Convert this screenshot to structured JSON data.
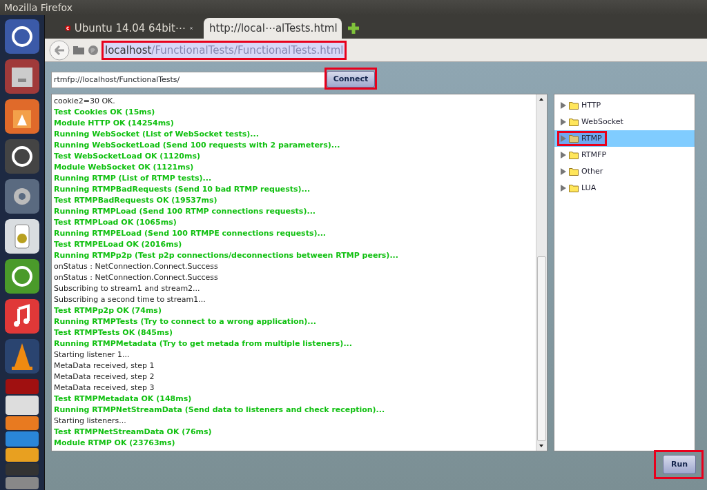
{
  "window": {
    "title": "Mozilla Firefox"
  },
  "tabs": [
    {
      "title": "Ubuntu 14.04 64bit⋯",
      "selected": false
    },
    {
      "title": "http://local⋯alTests.html",
      "selected": true
    }
  ],
  "address_bar": {
    "host": "localhost",
    "path": "/FunctionalTests/FunctionalTests.html",
    "highlighted": true
  },
  "server_field": {
    "value": "rtmfp://localhost/FunctionalTests/"
  },
  "connect_button": {
    "label": "Connect",
    "highlighted": true
  },
  "log": {
    "lines": [
      {
        "text": "cookie2=30 OK.",
        "kind": "info"
      },
      {
        "text": "Test Cookies OK (15ms)",
        "kind": "success"
      },
      {
        "text": "Module HTTP OK (14254ms)",
        "kind": "success"
      },
      {
        "text": "Running WebSocket (List of WebSocket tests)...",
        "kind": "success"
      },
      {
        "text": "Running WebSocketLoad (Send 100 requests with 2 parameters)...",
        "kind": "success"
      },
      {
        "text": "Test WebSocketLoad OK (1120ms)",
        "kind": "success"
      },
      {
        "text": "Module WebSocket OK (1121ms)",
        "kind": "success"
      },
      {
        "text": "Running RTMP (List of RTMP tests)...",
        "kind": "success"
      },
      {
        "text": "Running RTMPBadRequests (Send 10 bad RTMP requests)...",
        "kind": "success"
      },
      {
        "text": "Test RTMPBadRequests OK (19537ms)",
        "kind": "success"
      },
      {
        "text": "Running RTMPLoad (Send 100 RTMP connections requests)...",
        "kind": "success"
      },
      {
        "text": "Test RTMPLoad OK (1065ms)",
        "kind": "success"
      },
      {
        "text": "Running RTMPELoad (Send 100 RTMPE connections requests)...",
        "kind": "success"
      },
      {
        "text": "Test RTMPELoad OK (2016ms)",
        "kind": "success"
      },
      {
        "text": "Running RTMPp2p (Test p2p connections/deconnections between RTMP peers)...",
        "kind": "success"
      },
      {
        "text": "onStatus : NetConnection.Connect.Success",
        "kind": "info"
      },
      {
        "text": "onStatus : NetConnection.Connect.Success",
        "kind": "info"
      },
      {
        "text": "Subscribing to stream1 and stream2...",
        "kind": "info"
      },
      {
        "text": "Subscribing a second time to stream1...",
        "kind": "info"
      },
      {
        "text": "Test RTMPp2p OK (74ms)",
        "kind": "success"
      },
      {
        "text": "Running RTMPTests (Try to connect to a wrong application)...",
        "kind": "success"
      },
      {
        "text": "Test RTMPTests OK (845ms)",
        "kind": "success"
      },
      {
        "text": "Running RTMPMetadata (Try to get metada from multiple listeners)...",
        "kind": "success"
      },
      {
        "text": "Starting listener 1...",
        "kind": "info"
      },
      {
        "text": "MetaData received, step 1",
        "kind": "info"
      },
      {
        "text": "MetaData received, step 2",
        "kind": "info"
      },
      {
        "text": "MetaData received, step 3",
        "kind": "info"
      },
      {
        "text": "Test RTMPMetadata OK (148ms)",
        "kind": "success"
      },
      {
        "text": "Running RTMPNetStreamData (Send data to listeners and check reception)...",
        "kind": "success"
      },
      {
        "text": "Starting listeners...",
        "kind": "info"
      },
      {
        "text": "Test RTMPNetStreamData OK (76ms)",
        "kind": "success"
      },
      {
        "text": "Module RTMP OK (23763ms)",
        "kind": "success"
      }
    ]
  },
  "tree": {
    "items": [
      {
        "label": "HTTP",
        "selected": false,
        "highlighted": false
      },
      {
        "label": "WebSocket",
        "selected": false,
        "highlighted": false
      },
      {
        "label": "RTMP",
        "selected": true,
        "highlighted": true
      },
      {
        "label": "RTMFP",
        "selected": false,
        "highlighted": false
      },
      {
        "label": "Other",
        "selected": false,
        "highlighted": false
      },
      {
        "label": "LUA",
        "selected": false,
        "highlighted": false
      }
    ]
  },
  "run_button": {
    "label": "Run",
    "highlighted": true
  }
}
